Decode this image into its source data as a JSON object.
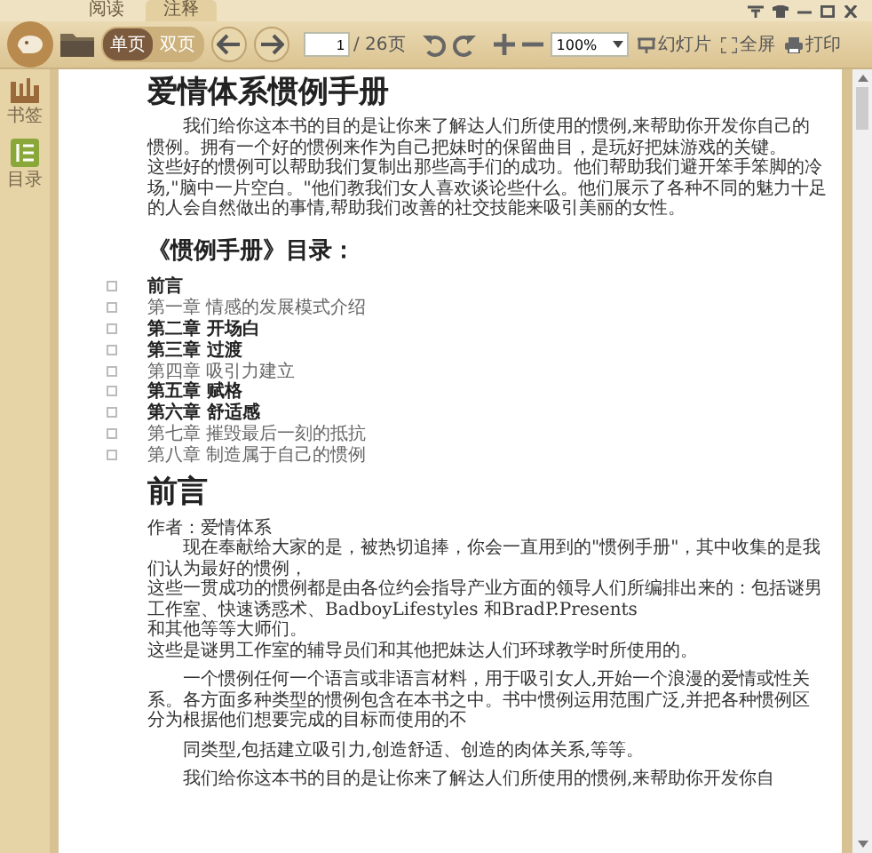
{
  "tabs": [
    {
      "label": "阅读",
      "selected": false
    },
    {
      "label": "注释",
      "selected": true
    }
  ],
  "toolbar": {
    "view_modes": [
      {
        "label": "单页",
        "selected": true
      },
      {
        "label": "双页",
        "selected": false
      }
    ],
    "page_input": "1",
    "page_total": "/ 26页",
    "zoom": "100%",
    "actions": [
      {
        "kind": "slideshow",
        "label": "幻灯片"
      },
      {
        "kind": "fullscreen",
        "label": "全屏"
      },
      {
        "kind": "print",
        "label": "打印"
      }
    ]
  },
  "sidebar": {
    "items": [
      {
        "kind": "bookmark",
        "label": "书签",
        "selected": false
      },
      {
        "kind": "toc",
        "label": "目录",
        "selected": true
      }
    ]
  },
  "document": {
    "title": "爱情体系惯例手册",
    "intro": [
      {
        "text": "我们给你这本书的目的是让你来了解达人们所使用的惯例,来帮助你开发你自己的惯例。拥有一个好的惯例来作为自己把妹时的保留曲目，是玩好把妹游戏的关键。",
        "indent": true
      },
      {
        "text": "这些好的惯例可以帮助我们复制出那些高手们的成功。他们帮助我们避开笨手笨脚的冷场,\"脑中一片空白。\"他们教我们女人喜欢谈论些什么。他们展示了各种不同的魅力十足的人会自然做出的事情,帮助我们改善的社交技能来吸引美丽的女性。",
        "indent": false
      }
    ],
    "toc_title": "《惯例手册》目录：",
    "toc": [
      {
        "text": "前言",
        "kind": "bold"
      },
      {
        "text": "第一章 情感的发展模式介绍",
        "kind": "plain"
      },
      {
        "text": "第二章 开场白",
        "kind": "bold"
      },
      {
        "text": "第三章 过渡",
        "kind": "bold"
      },
      {
        "text": "第四章 吸引力建立",
        "kind": "plain"
      },
      {
        "text": "第五章 赋格",
        "kind": "bold"
      },
      {
        "text": "第六章 舒适感",
        "kind": "bold"
      },
      {
        "text": "第七章 摧毁最后一刻的抵抗",
        "kind": "plain"
      },
      {
        "text": "第八章 制造属于自己的惯例",
        "kind": "plain"
      }
    ],
    "section_title": "前言",
    "body": [
      {
        "paragraphs": [
          {
            "text": "作者：爱情体系",
            "indent": false
          },
          {
            "text": "现在奉献给大家的是，被热切追捧，你会一直用到的\"惯例手册\"，其中收集的是我们认为最好的惯例，",
            "indent": true
          },
          {
            "text": "这些一贯成功的惯例都是由各位约会指导产业方面的领导人们所编排出来的：包括谜男工作室、快速诱惑术、BadboyLifestyles 和BradP.Presents",
            "indent": false
          },
          {
            "text": "和其他等等大师们。",
            "indent": false
          },
          {
            "text": "这些是谜男工作室的辅导员们和其他把妹达人们环球教学时所使用的。",
            "indent": false
          }
        ]
      },
      {
        "paragraphs": [
          {
            "text": "一个惯例任何一个语言或非语言材料，用于吸引女人,开始一个浪漫的爱情或性关系。各方面多种类型的惯例包含在本书之中。书中惯例运用范围广泛,并把各种惯例区分为根据他们想要完成的目标而使用的不",
            "indent": true
          }
        ]
      },
      {
        "paragraphs": [
          {
            "text": "同类型,包括建立吸引力,创造舒适、创造的肉体关系,等等。",
            "indent": true
          }
        ]
      },
      {
        "paragraphs": [
          {
            "text": "我们给你这本书的目的是让你来了解达人们所使用的惯例,来帮助你开发你自",
            "indent": true
          }
        ]
      }
    ]
  }
}
